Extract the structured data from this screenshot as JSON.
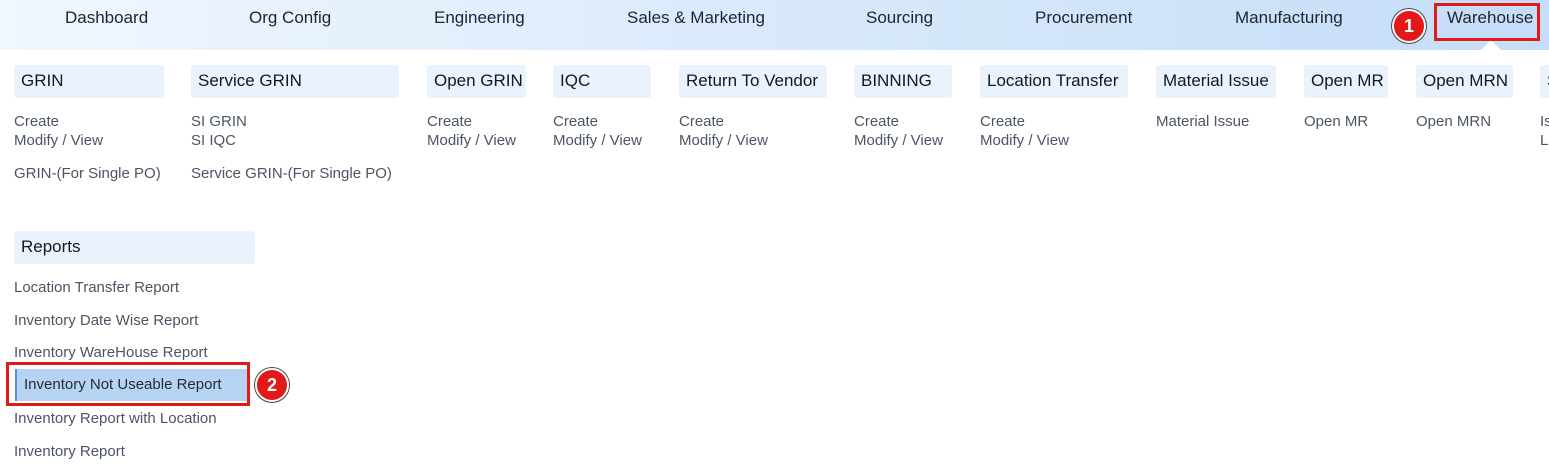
{
  "nav": {
    "items": [
      "Dashboard",
      "Org Config",
      "Engineering",
      "Sales & Marketing",
      "Sourcing",
      "Procurement",
      "Manufacturing",
      "Warehouse"
    ],
    "active": "Warehouse"
  },
  "annotations": {
    "badge1": "1",
    "badge2": "2",
    "color": "#e01919"
  },
  "columns": [
    {
      "header": "GRIN",
      "links": [
        "Create",
        "Modify / View",
        "GRIN-(For Single PO)"
      ]
    },
    {
      "header": "Service GRIN",
      "links": [
        "SI GRIN",
        "SI IQC",
        "Service GRIN-(For Single PO)"
      ]
    },
    {
      "header": "Open GRIN",
      "links": [
        "Create",
        "Modify / View"
      ]
    },
    {
      "header": "IQC",
      "links": [
        "Create",
        "Modify / View"
      ]
    },
    {
      "header": "Return To Vendor",
      "links": [
        "Create",
        "Modify / View"
      ]
    },
    {
      "header": "BINNING",
      "links": [
        "Create",
        "Modify / View"
      ]
    },
    {
      "header": "Location Transfer",
      "links": [
        "Create",
        "Modify / View"
      ]
    },
    {
      "header": "Material Issue",
      "links": [
        "Material Issue"
      ]
    },
    {
      "header": "Open MR",
      "links": [
        "Open MR"
      ]
    },
    {
      "header": "Open MRN",
      "links": [
        "Open MRN"
      ]
    },
    {
      "header": "S",
      "links": [
        "Is",
        "L"
      ]
    }
  ],
  "reports": {
    "header": "Reports",
    "links": [
      "Location Transfer Report",
      "Inventory Date Wise Report",
      "Inventory WareHouse Report",
      "Inventory Not Useable Report",
      "Inventory Report with Location",
      "Inventory Report"
    ],
    "active_index": 3
  }
}
